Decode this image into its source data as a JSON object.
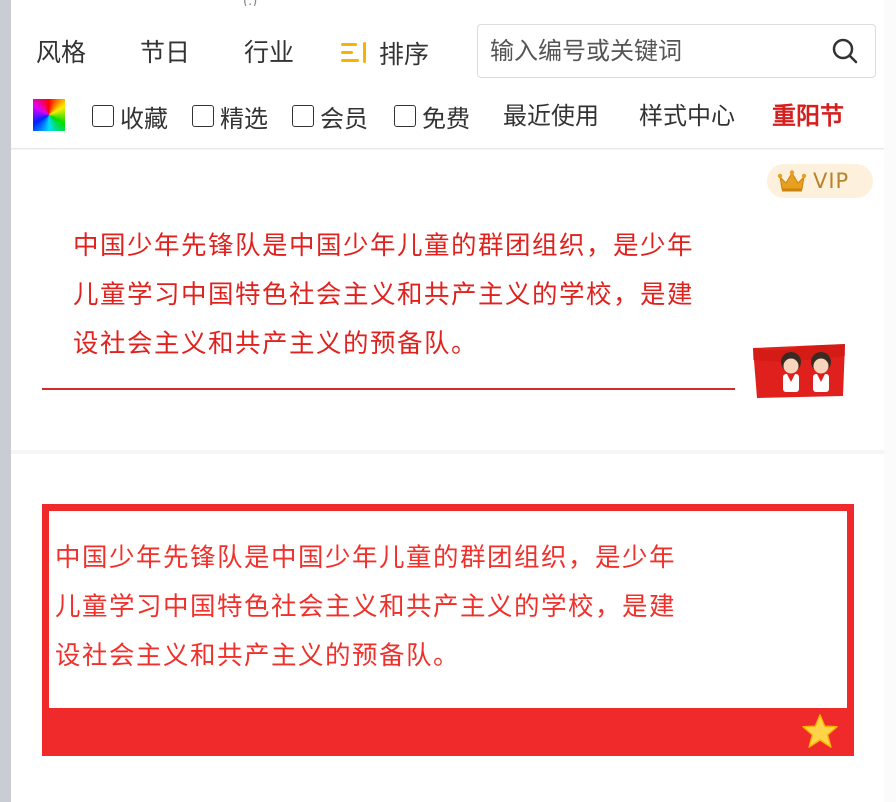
{
  "top_artifact": "(.)",
  "categories": [
    "风格",
    "节日",
    "行业"
  ],
  "sort_label": "排序",
  "search": {
    "placeholder": "输入编号或关键词"
  },
  "filters": [
    "收藏",
    "精选",
    "会员",
    "免费"
  ],
  "links": {
    "recent": "最近使用",
    "style_center": "样式中心",
    "active_festival": "重阳节"
  },
  "colors": {
    "accent": "#d41f1f",
    "template_red": "#f02a2a",
    "sort_icon": "#f5b400",
    "vip_text": "#b8842a"
  },
  "cards": [
    {
      "badge": "VIP",
      "lines": [
        "中国少年先锋队是中国少年儿童的群团组织，是少年",
        "儿童学习中国特色社会主义和共产主义的学校，是建",
        "设社会主义和共产主义的预备队。"
      ],
      "decoration": "young-pioneers-flag-illustration"
    },
    {
      "lines": [
        "中国少年先锋队是中国少年儿童的群团组织，是少年",
        "儿童学习中国特色社会主义和共产主义的学校，是建",
        "设社会主义和共产主义的预备队。"
      ],
      "decoration": "star-icon"
    }
  ]
}
